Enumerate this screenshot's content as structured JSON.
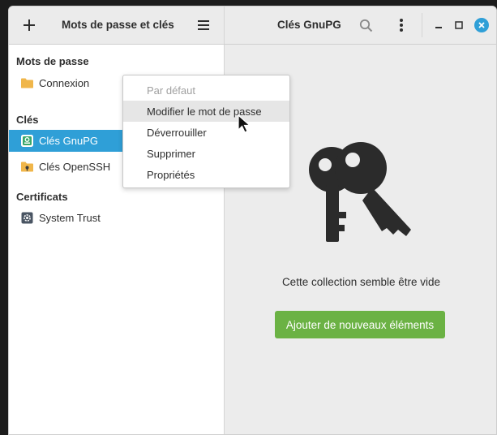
{
  "window": {
    "left_title": "Mots de passe et clés",
    "right_title": "Clés GnuPG"
  },
  "sidebar": {
    "sections": [
      {
        "label": "Mots de passe",
        "items": [
          {
            "label": "Connexion",
            "icon": "folder-icon"
          }
        ]
      },
      {
        "label": "Clés",
        "items": [
          {
            "label": "Clés GnuPG",
            "icon": "gnupg-keyring-icon",
            "selected": true
          },
          {
            "label": "Clés OpenSSH",
            "icon": "folder-key-icon"
          }
        ]
      },
      {
        "label": "Certificats",
        "items": [
          {
            "label": "System Trust",
            "icon": "gear-icon"
          }
        ]
      }
    ]
  },
  "context_menu": {
    "items": [
      {
        "label": "Par défaut",
        "disabled": true
      },
      {
        "label": "Modifier le mot de passe",
        "hover": true
      },
      {
        "label": "Déverrouiller"
      },
      {
        "label": "Supprimer"
      },
      {
        "label": "Propriétés"
      }
    ]
  },
  "main": {
    "empty_text": "Cette collection semble être vide",
    "add_button": "Ajouter de nouveaux éléments"
  },
  "colors": {
    "accent": "#2f9fd7",
    "add_button": "#6bb244",
    "close_button": "#2f9fd7"
  }
}
